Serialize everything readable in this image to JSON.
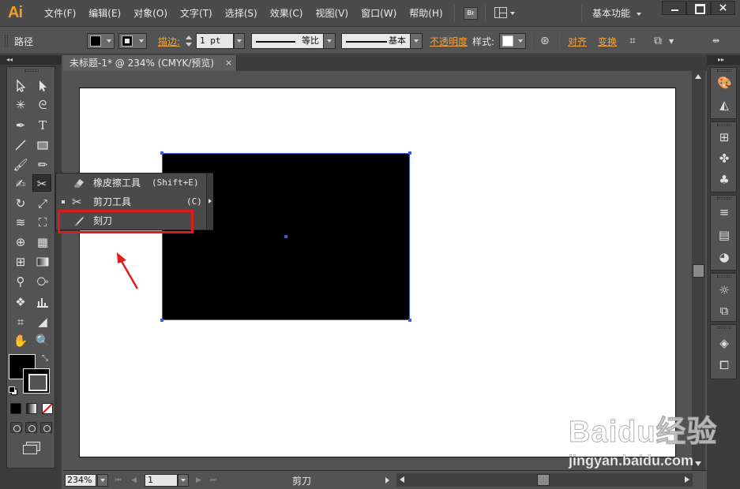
{
  "app": {
    "logo": "Ai"
  },
  "menu": [
    "文件(F)",
    "编辑(E)",
    "对象(O)",
    "文字(T)",
    "选择(S)",
    "效果(C)",
    "视图(V)",
    "窗口(W)",
    "帮助(H)"
  ],
  "bridge_button": "Br",
  "workspace": "基本功能",
  "window_controls": {
    "close": "×"
  },
  "control_bar": {
    "selection_type": "路径",
    "stroke_label": "描边:",
    "stroke_weight": "1 pt",
    "profile_label": "等比",
    "brush_label": "基本",
    "opacity_label": "不透明度",
    "style_label": "样式:",
    "align_label": "对齐",
    "transform_label": "变换"
  },
  "document": {
    "tab_title": "未标题-1* @ 234% (CMYK/预览)",
    "tab_close": "×"
  },
  "flyout": {
    "items": [
      {
        "label": "橡皮擦工具",
        "shortcut": "(Shift+E)",
        "icon": "eraser-icon",
        "current": false
      },
      {
        "label": "剪刀工具",
        "shortcut": "(C)",
        "icon": "scissors-icon",
        "current": true
      },
      {
        "label": "刻刀",
        "shortcut": "",
        "icon": "knife-icon",
        "current": false
      }
    ]
  },
  "status_bar": {
    "zoom": "234%",
    "page": "1",
    "current_tool": "剪刀"
  },
  "colors": {
    "annotation_red": "#e11a1a",
    "selection_blue": "#3c5bd8",
    "accent_orange": "#f29d2a"
  },
  "watermark": {
    "logo": "Baidu经验",
    "url": "jingyan.baidu.com"
  }
}
